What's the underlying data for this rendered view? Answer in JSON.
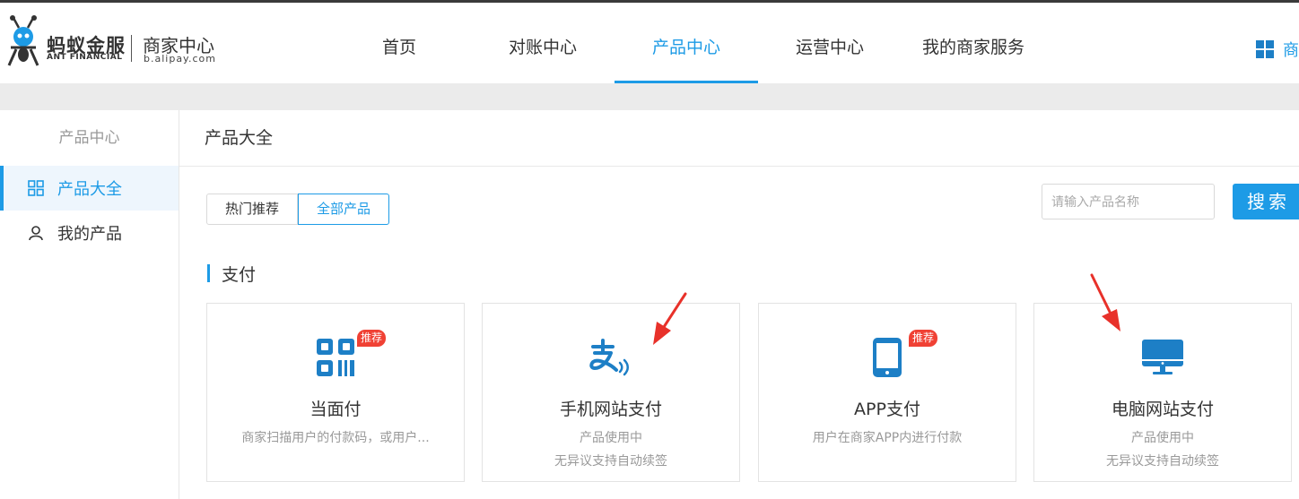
{
  "header": {
    "logo_cn": "蚂蚁金服",
    "logo_en": "ANT FINANCIAL",
    "logo_sub": "商家中心",
    "logo_url": "b.alipay.com",
    "nav": [
      {
        "label": "首页"
      },
      {
        "label": "对账中心"
      },
      {
        "label": "产品中心"
      },
      {
        "label": "运营中心"
      },
      {
        "label": "我的商家服务"
      }
    ],
    "active_nav": "产品中心",
    "merchant_label": "商"
  },
  "sidebar": {
    "title": "产品中心",
    "items": [
      {
        "label": "产品大全",
        "icon": "grid-icon",
        "active": true
      },
      {
        "label": "我的产品",
        "icon": "user-icon",
        "active": false
      }
    ]
  },
  "main": {
    "title": "产品大全",
    "tabs": [
      {
        "label": "热门推荐"
      },
      {
        "label": "全部产品"
      }
    ],
    "active_tab": "全部产品",
    "search": {
      "placeholder": "请输入产品名称",
      "button_label": "搜索"
    },
    "section_label": "支付",
    "cards": [
      {
        "name": "当面付",
        "desc1": "商家扫描用户的付款码，或用户...",
        "desc2": "",
        "badge": "推荐",
        "icon": "qr-code-icon"
      },
      {
        "name": "手机网站支付",
        "desc1": "产品使用中",
        "desc2": "无异议支持自动续签",
        "badge": "",
        "icon": "alipay-icon"
      },
      {
        "name": "APP支付",
        "desc1": "用户在商家APP内进行付款",
        "desc2": "",
        "badge": "推荐",
        "icon": "mobile-phone-icon"
      },
      {
        "name": "电脑网站支付",
        "desc1": "产品使用中",
        "desc2": "无异议支持自动续签",
        "badge": "",
        "icon": "desktop-monitor-icon"
      }
    ]
  },
  "colors": {
    "accent": "#1d9be6",
    "badge": "#f04134",
    "annotation_arrow": "#e8312a"
  }
}
